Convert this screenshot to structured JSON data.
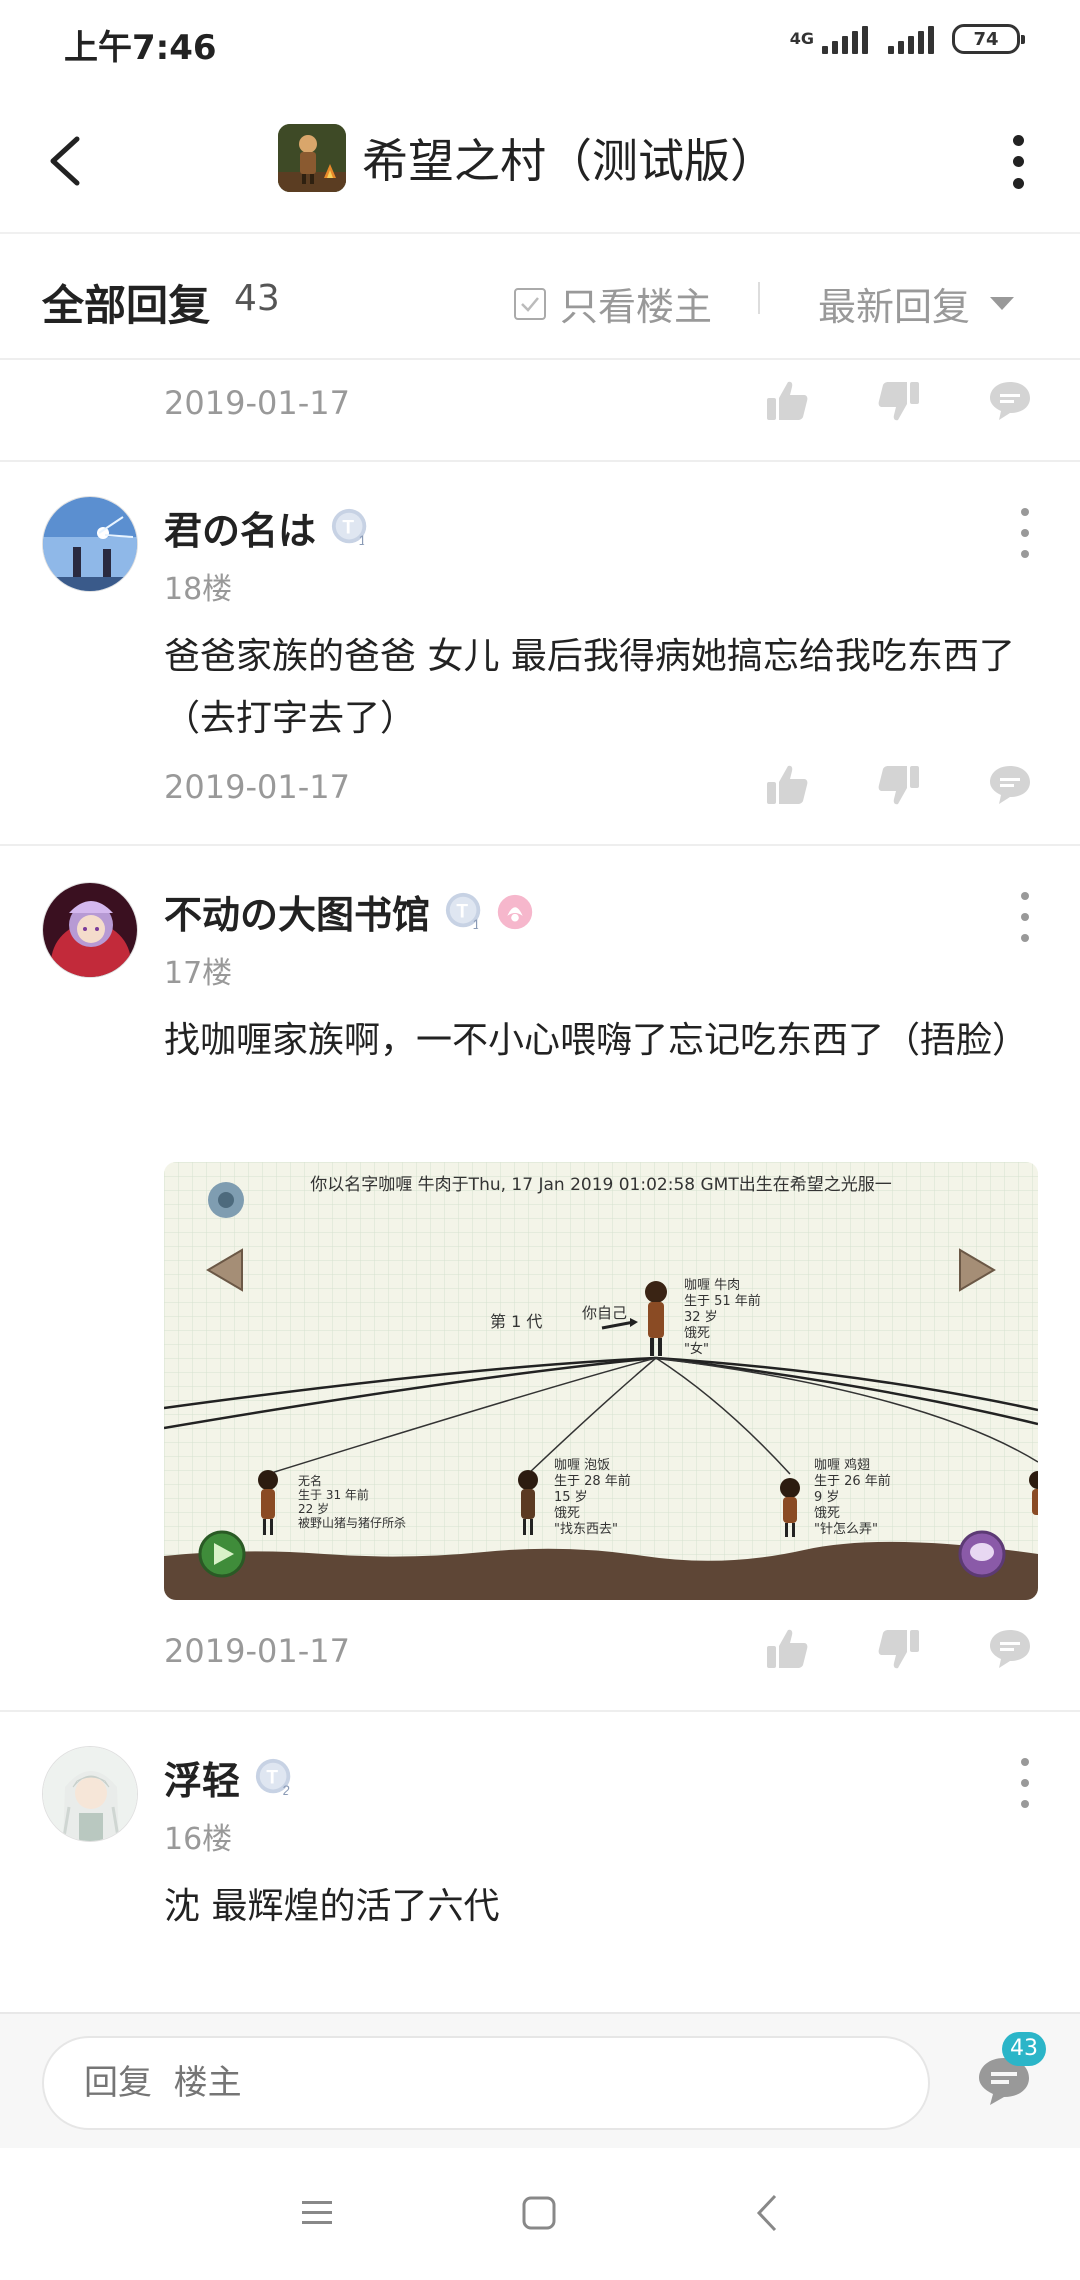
{
  "status_bar": {
    "time": "上午7:46",
    "network": "4G",
    "battery": "74"
  },
  "header": {
    "title": "希望之村（测试版）"
  },
  "filter": {
    "all_replies_label": "全部回复",
    "reply_count": "43",
    "only_op_label": "只看楼主",
    "sort_label": "最新回复"
  },
  "top_item": {
    "date": "2019-01-17"
  },
  "posts": [
    {
      "author": "君の名は",
      "floor": "18楼",
      "text": "爸爸家族的爸爸 女儿 最后我得病她搞忘给我吃东西了（去打字去了）",
      "date": "2019-01-17"
    },
    {
      "author": "不动の大图书馆",
      "floor": "17楼",
      "text": "找咖喱家族啊，一不小心喂嗨了忘记吃东西了（捂脸）",
      "date": "2019-01-17",
      "image": {
        "banner": "你以名字咖喱 牛肉于Thu, 17 Jan 2019 01:02:58 GMT出生在希望之光服一",
        "generation": "第 1 代",
        "you_label": "你自己",
        "self_info": [
          "咖喱 牛肉",
          "生于 51 年前",
          "32 岁",
          "饿死",
          "\"女\""
        ],
        "child1_info": [
          "无名",
          "生于 31 年前",
          "22 岁",
          "被野山猪与猪仔所杀"
        ],
        "child2_info": [
          "咖喱 泡饭",
          "生于 28 年前",
          "15 岁",
          "饿死",
          "\"找东西去\""
        ],
        "child3_info": [
          "咖喱 鸡翅",
          "生于 26 年前",
          "9 岁",
          "饿死",
          "\"针怎么弄\""
        ]
      }
    },
    {
      "author": "浮轻",
      "floor": "16楼",
      "text": "沈 最辉煌的活了六代"
    }
  ],
  "reply_bar": {
    "placeholder": "回复  楼主",
    "count": "43"
  },
  "colors": {
    "accent": "#2bb5c8",
    "muted": "#999999"
  }
}
